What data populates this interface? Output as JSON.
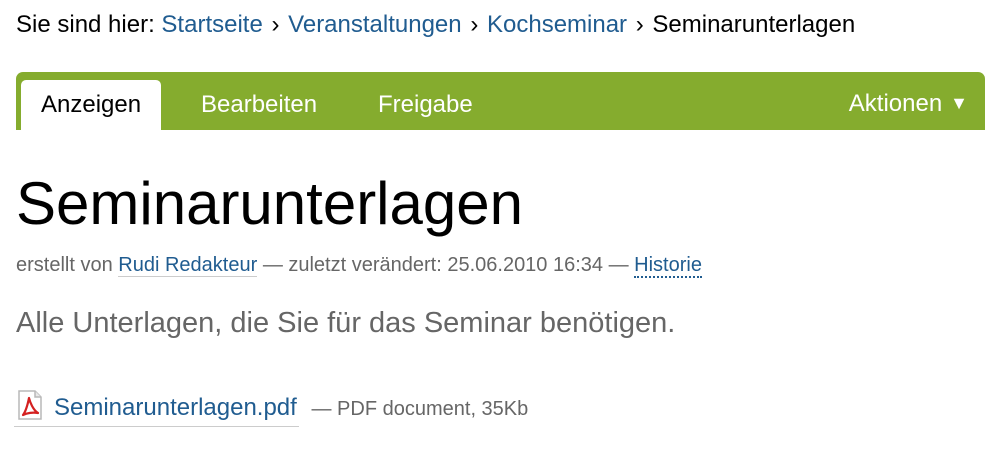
{
  "breadcrumb": {
    "prefix": "Sie sind hier:",
    "separator": "›",
    "items": [
      {
        "label": "Startseite"
      },
      {
        "label": "Veranstaltungen"
      },
      {
        "label": "Kochseminar"
      }
    ],
    "current": "Seminarunterlagen"
  },
  "tabs": {
    "view": "Anzeigen",
    "edit": "Bearbeiten",
    "share": "Freigabe",
    "actions": "Aktionen",
    "actions_arrow": "▼"
  },
  "colors": {
    "tabbar": "#85ac2e",
    "link": "#205c90",
    "muted": "#666666"
  },
  "page": {
    "title": "Seminarunterlagen",
    "byline_prefix": "erstellt von",
    "author": "Rudi Redakteur",
    "modified_prefix": "— zuletzt verändert: 25.06.2010 16:34 —",
    "history": "Historie",
    "description": "Alle Unterlagen, die Sie für das Seminar benötigen."
  },
  "file": {
    "icon": "pdf-icon",
    "name": "Seminarunterlagen.pdf",
    "meta": "— PDF document, 35Kb"
  }
}
